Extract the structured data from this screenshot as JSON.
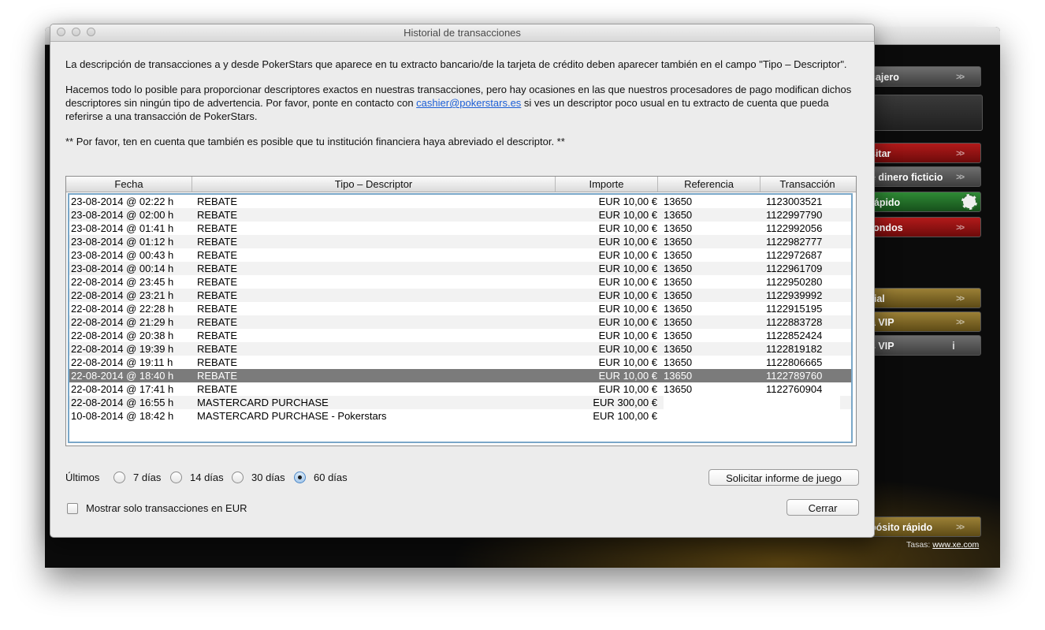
{
  "window": {
    "title": "Historial de transacciones"
  },
  "intro": {
    "p1": "La descripción de transacciones a y desde PokerStars que aparece en tu extracto bancario/de la tarjeta de crédito deben aparecer también en el campo \"Tipo – Descriptor\".",
    "p2_before": "Hacemos todo lo posible para proporcionar descriptores exactos en nuestras transacciones, pero hay ocasiones en las que nuestros procesadores de pago modifican dichos descriptores sin ningún tipo de advertencia. Por favor, ponte en contacto con ",
    "p2_link": "cashier@pokerstars.es",
    "p2_after": " si ves un descriptor poco usual en tu extracto de cuenta que pueda referirse a una transacción de PokerStars.",
    "p3": "** Por favor, ten en cuenta que también es posible que tu institución financiera haya abreviado el descriptor. **"
  },
  "table": {
    "columns": [
      "Fecha",
      "Tipo – Descriptor",
      "Importe",
      "Referencia",
      "Transacción"
    ],
    "rows": [
      {
        "date": "23-08-2014 @ 02:22 h",
        "desc": "REBATE",
        "amount": "EUR 10,00 €",
        "ref": "13650",
        "tx": "1123003521"
      },
      {
        "date": "23-08-2014 @ 02:00 h",
        "desc": "REBATE",
        "amount": "EUR 10,00 €",
        "ref": "13650",
        "tx": "1122997790"
      },
      {
        "date": "23-08-2014 @ 01:41 h",
        "desc": "REBATE",
        "amount": "EUR 10,00 €",
        "ref": "13650",
        "tx": "1122992056"
      },
      {
        "date": "23-08-2014 @ 01:12 h",
        "desc": "REBATE",
        "amount": "EUR 10,00 €",
        "ref": "13650",
        "tx": "1122982777"
      },
      {
        "date": "23-08-2014 @ 00:43 h",
        "desc": "REBATE",
        "amount": "EUR 10,00 €",
        "ref": "13650",
        "tx": "1122972687"
      },
      {
        "date": "23-08-2014 @ 00:14 h",
        "desc": "REBATE",
        "amount": "EUR 10,00 €",
        "ref": "13650",
        "tx": "1122961709"
      },
      {
        "date": "22-08-2014 @ 23:45 h",
        "desc": "REBATE",
        "amount": "EUR 10,00 €",
        "ref": "13650",
        "tx": "1122950280"
      },
      {
        "date": "22-08-2014 @ 23:21 h",
        "desc": "REBATE",
        "amount": "EUR 10,00 €",
        "ref": "13650",
        "tx": "1122939992"
      },
      {
        "date": "22-08-2014 @ 22:28 h",
        "desc": "REBATE",
        "amount": "EUR 10,00 €",
        "ref": "13650",
        "tx": "1122915195"
      },
      {
        "date": "22-08-2014 @ 21:29 h",
        "desc": "REBATE",
        "amount": "EUR 10,00 €",
        "ref": "13650",
        "tx": "1122883728"
      },
      {
        "date": "22-08-2014 @ 20:38 h",
        "desc": "REBATE",
        "amount": "EUR 10,00 €",
        "ref": "13650",
        "tx": "1122852424"
      },
      {
        "date": "22-08-2014 @ 19:39 h",
        "desc": "REBATE",
        "amount": "EUR 10,00 €",
        "ref": "13650",
        "tx": "1122819182"
      },
      {
        "date": "22-08-2014 @ 19:11 h",
        "desc": "REBATE",
        "amount": "EUR 10,00 €",
        "ref": "13650",
        "tx": "1122806665"
      },
      {
        "date": "22-08-2014 @ 18:40 h",
        "desc": "REBATE",
        "amount": "EUR 10,00 €",
        "ref": "13650",
        "tx": "1122789760",
        "selected": true
      },
      {
        "date": "22-08-2014 @ 17:41 h",
        "desc": "REBATE",
        "amount": "EUR 10,00 €",
        "ref": "13650",
        "tx": "1122760904"
      },
      {
        "date": "22-08-2014 @ 16:55 h",
        "desc": "MASTERCARD PURCHASE",
        "amount": "EUR 300,00 €",
        "ref": "",
        "tx": "",
        "redacted": true
      },
      {
        "date": "10-08-2014 @ 18:42 h",
        "desc": "MASTERCARD PURCHASE - Pokerstars",
        "amount": "EUR 100,00 €",
        "ref": "",
        "tx": "",
        "redacted": true
      }
    ]
  },
  "filters": {
    "label": "Últimos",
    "options": [
      "7 días",
      "14 días",
      "30 días",
      "60 días"
    ],
    "selected_index": 3,
    "eur_only_label": "Mostrar solo transacciones en EUR",
    "eur_only_checked": false
  },
  "buttons": {
    "request_report": "Solicitar informe de juego",
    "close": "Cerrar"
  },
  "background": {
    "side_buttons": [
      {
        "label": "cajero",
        "style": "gray"
      },
      {
        "label": "sitar",
        "style": "red"
      },
      {
        "label": "e dinero ficticio",
        "style": "gray"
      },
      {
        "label": "rápido",
        "style": "green"
      },
      {
        "label": "fondos",
        "style": "red"
      },
      {
        "label": "rial",
        "style": "gold"
      },
      {
        "label": "a VIP",
        "style": "gold"
      },
      {
        "label": "s VIP",
        "style": "gray"
      },
      {
        "label": "pósito rápido",
        "style": "gold"
      }
    ],
    "rates_label": "Tasas:",
    "rates_link": "www.xe.com"
  },
  "icons": {
    "arrows": "double-chevron-right-icon",
    "chip": "poker-chip-icon",
    "info": "info-icon"
  }
}
